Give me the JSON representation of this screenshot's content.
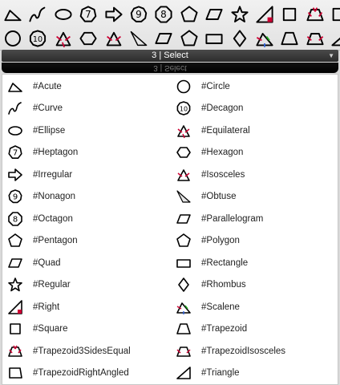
{
  "toolbar": {
    "row1": [
      "triangle-acute-icon",
      "curve-icon",
      "ellipse-icon",
      "heptagon-icon",
      "irregular-arrow-icon",
      "nonagon-icon",
      "octagon-icon",
      "pentagon-icon",
      "parallelogram-icon",
      "star-icon",
      "right-triangle-icon",
      "square-icon",
      "trapezoid-3-sides-equal-icon",
      "trapezoid-right-angled-icon"
    ],
    "row2": [
      "circle-icon",
      "decagon-icon",
      "equilateral-icon",
      "hexagon-icon",
      "isosceles-icon",
      "obtuse-icon",
      "parallelogram-icon",
      "polygon-icon",
      "rectangle-icon",
      "rhombus-icon",
      "scalene-icon",
      "trapezoid-icon",
      "trapezoid-isosceles-icon",
      "triangle-icon"
    ]
  },
  "select_bar": {
    "label": "3 | Select"
  },
  "dropdown": {
    "items": [
      {
        "label": "#Acute",
        "icon": "acute-icon"
      },
      {
        "label": "#Circle",
        "icon": "circle-icon"
      },
      {
        "label": "#Curve",
        "icon": "curve-icon"
      },
      {
        "label": "#Decagon",
        "icon": "decagon-icon"
      },
      {
        "label": "#Ellipse",
        "icon": "ellipse-icon"
      },
      {
        "label": "#Equilateral",
        "icon": "equilateral-icon"
      },
      {
        "label": "#Heptagon",
        "icon": "heptagon-icon"
      },
      {
        "label": "#Hexagon",
        "icon": "hexagon-icon"
      },
      {
        "label": "#Irregular",
        "icon": "irregular-icon"
      },
      {
        "label": "#Isosceles",
        "icon": "isosceles-icon"
      },
      {
        "label": "#Nonagon",
        "icon": "nonagon-icon"
      },
      {
        "label": "#Obtuse",
        "icon": "obtuse-icon"
      },
      {
        "label": "#Octagon",
        "icon": "octagon-icon"
      },
      {
        "label": "#Parallelogram",
        "icon": "parallelogram-icon"
      },
      {
        "label": "#Pentagon",
        "icon": "pentagon-icon"
      },
      {
        "label": "#Polygon",
        "icon": "polygon-icon"
      },
      {
        "label": "#Quad",
        "icon": "quad-icon"
      },
      {
        "label": "#Rectangle",
        "icon": "rectangle-icon"
      },
      {
        "label": "#Regular",
        "icon": "regular-icon"
      },
      {
        "label": "#Rhombus",
        "icon": "rhombus-icon"
      },
      {
        "label": "#Right",
        "icon": "right-icon"
      },
      {
        "label": "#Scalene",
        "icon": "scalene-icon"
      },
      {
        "label": "#Square",
        "icon": "square-icon"
      },
      {
        "label": "#Trapezoid",
        "icon": "trapezoid-icon"
      },
      {
        "label": "#Trapezoid3SidesEqual",
        "icon": "trapezoid-3-sides-equal-icon"
      },
      {
        "label": "#TrapezoidIsosceles",
        "icon": "trapezoid-isosceles-icon"
      },
      {
        "label": "#TrapezoidRightAngled",
        "icon": "trapezoid-right-angled-icon"
      },
      {
        "label": "#Triangle",
        "icon": "triangle-icon"
      }
    ]
  },
  "colors": {
    "bar": "#333333",
    "mark_red": "#cc0033",
    "mark_green": "#22aa22",
    "mark_blue": "#3366dd"
  }
}
